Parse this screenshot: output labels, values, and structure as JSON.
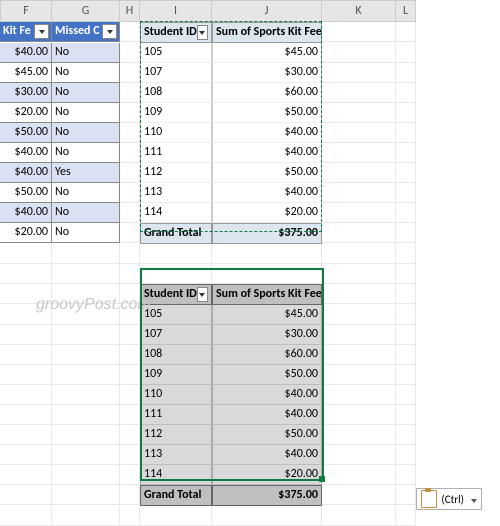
{
  "columns": [
    "F",
    "G",
    "H",
    "I",
    "J",
    "K",
    "L"
  ],
  "table1": {
    "headers": [
      "Kit Fe",
      "Missed C"
    ],
    "rows": [
      {
        "fee": "$40.00",
        "missed": "No"
      },
      {
        "fee": "$45.00",
        "missed": "No"
      },
      {
        "fee": "$30.00",
        "missed": "No"
      },
      {
        "fee": "$20.00",
        "missed": "No"
      },
      {
        "fee": "$50.00",
        "missed": "No"
      },
      {
        "fee": "$40.00",
        "missed": "No"
      },
      {
        "fee": "$40.00",
        "missed": "Yes"
      },
      {
        "fee": "$50.00",
        "missed": "No"
      },
      {
        "fee": "$40.00",
        "missed": "No"
      },
      {
        "fee": "$20.00",
        "missed": "No"
      }
    ]
  },
  "pivot": {
    "headers": [
      "Student ID",
      "Sum of Sports Kit Fee"
    ],
    "rows": [
      {
        "id": "105",
        "sum": "$45.00"
      },
      {
        "id": "107",
        "sum": "$30.00"
      },
      {
        "id": "108",
        "sum": "$60.00"
      },
      {
        "id": "109",
        "sum": "$50.00"
      },
      {
        "id": "110",
        "sum": "$40.00"
      },
      {
        "id": "111",
        "sum": "$40.00"
      },
      {
        "id": "112",
        "sum": "$50.00"
      },
      {
        "id": "113",
        "sum": "$40.00"
      },
      {
        "id": "114",
        "sum": "$20.00"
      }
    ],
    "total_label": "Grand Total",
    "total_value": "$375.00"
  },
  "pasted": {
    "headers": [
      "Student ID",
      "Sum of Sports Kit Fee"
    ],
    "rows": [
      {
        "id": "105",
        "sum": "$45.00"
      },
      {
        "id": "107",
        "sum": "$30.00"
      },
      {
        "id": "108",
        "sum": "$60.00"
      },
      {
        "id": "109",
        "sum": "$50.00"
      },
      {
        "id": "110",
        "sum": "$40.00"
      },
      {
        "id": "111",
        "sum": "$40.00"
      },
      {
        "id": "112",
        "sum": "$50.00"
      },
      {
        "id": "113",
        "sum": "$40.00"
      },
      {
        "id": "114",
        "sum": "$20.00"
      }
    ],
    "total_label": "Grand Total",
    "total_value": "$375.00"
  },
  "paste_options_label": "(Ctrl)",
  "watermark": "groovyPost.com"
}
